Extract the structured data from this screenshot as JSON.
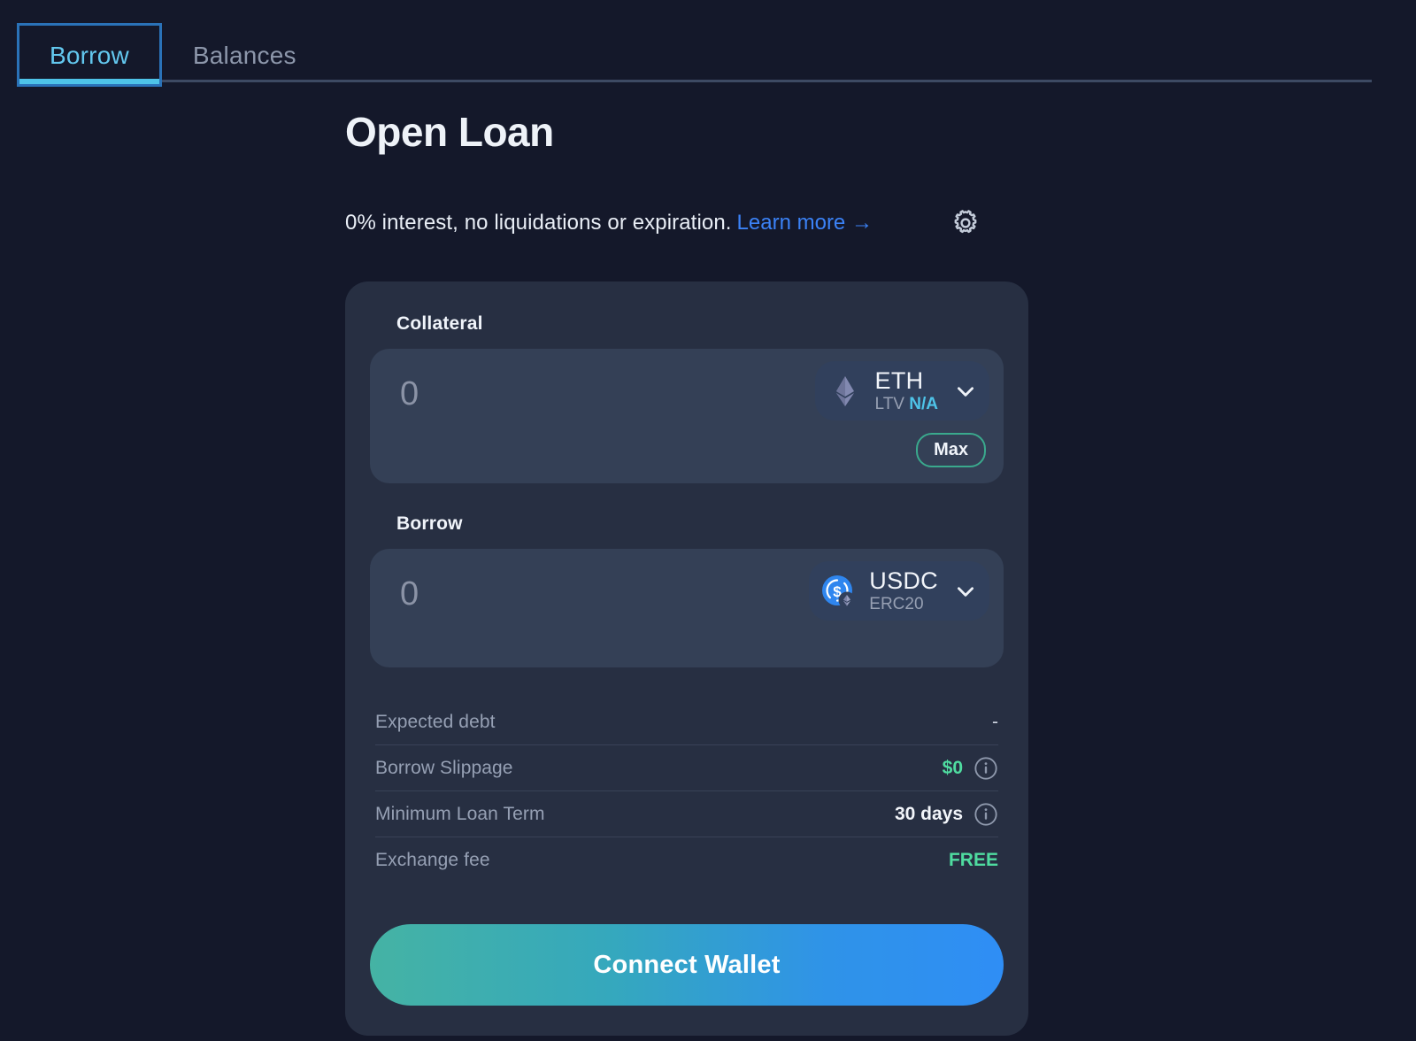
{
  "tabs": [
    {
      "label": "Borrow",
      "active": true
    },
    {
      "label": "Balances",
      "active": false
    }
  ],
  "header": {
    "title": "Open Loan",
    "subtitle": "0% interest, no liquidations or expiration.",
    "learn_more": "Learn more →",
    "settings_icon": "gear-icon"
  },
  "collateral": {
    "label": "Collateral",
    "amount_value": "",
    "amount_placeholder": "0",
    "token_symbol": "ETH",
    "token_sub_label": "LTV",
    "token_sub_value": "N/A",
    "token_logo": "eth-diamond-icon",
    "chevron_icon": "chevron-down-icon",
    "max_label": "Max"
  },
  "borrow": {
    "label": "Borrow",
    "amount_value": "",
    "amount_placeholder": "0",
    "token_symbol": "USDC",
    "token_sub_value": "ERC20",
    "token_logo": "usdc-coin-icon",
    "token_badge": "eth-diamond-badge-icon",
    "chevron_icon": "chevron-down-icon"
  },
  "details": [
    {
      "label": "Expected debt",
      "value": "-",
      "value_style": "plain",
      "info": false
    },
    {
      "label": "Borrow Slippage",
      "value": "$0",
      "value_style": "green",
      "info": true
    },
    {
      "label": "Minimum Loan Term",
      "value": "30 days",
      "value_style": "white",
      "info": true
    },
    {
      "label": "Exchange fee",
      "value": "FREE",
      "value_style": "green",
      "info": false
    }
  ],
  "cta": {
    "label": "Connect Wallet"
  },
  "colors": {
    "page_bg": "#14182a",
    "card_bg": "#272f42",
    "field_bg": "#344056",
    "accent_cyan": "#4ec3e8",
    "accent_blue": "#3b82f6",
    "accent_green": "#4fdca0",
    "accent_teal": "#3aa98d",
    "usdc_blue": "#2775ca"
  }
}
